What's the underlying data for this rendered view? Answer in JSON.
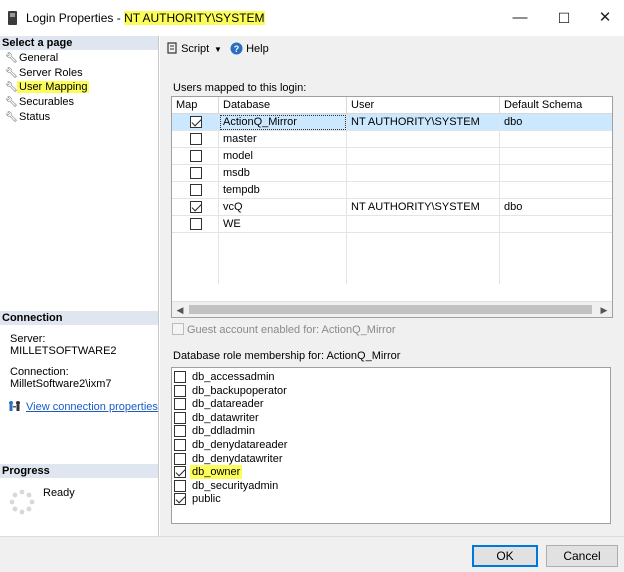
{
  "window": {
    "title_prefix": "Login Properties - ",
    "title_login": "NT AUTHORITY\\SYSTEM",
    "minimize_glyph": "—",
    "maximize_glyph": "☐",
    "close_glyph": "✕"
  },
  "left": {
    "select_page_header": "Select a page",
    "pages": [
      {
        "label": "General"
      },
      {
        "label": "Server Roles"
      },
      {
        "label": "User Mapping"
      },
      {
        "label": "Securables"
      },
      {
        "label": "Status"
      }
    ],
    "connection": {
      "header": "Connection",
      "server_label": "Server:",
      "server_value": "MILLETSOFTWARE2",
      "connection_label": "Connection:",
      "connection_value": "MilletSoftware2\\ixm7",
      "view_link": "View connection properties"
    },
    "progress": {
      "header": "Progress",
      "status": "Ready"
    }
  },
  "toolbar": {
    "script_label": "Script",
    "help_label": "Help"
  },
  "mapping": {
    "users_label": "Users mapped to this login:",
    "columns": [
      "Map",
      "Database",
      "User",
      "Default Schema"
    ],
    "rows": [
      {
        "map": true,
        "database": "ActionQ_Mirror",
        "user": "NT AUTHORITY\\SYSTEM",
        "schema": "dbo"
      },
      {
        "map": false,
        "database": "master",
        "user": "",
        "schema": ""
      },
      {
        "map": false,
        "database": "model",
        "user": "",
        "schema": ""
      },
      {
        "map": false,
        "database": "msdb",
        "user": "",
        "schema": ""
      },
      {
        "map": false,
        "database": "tempdb",
        "user": "",
        "schema": ""
      },
      {
        "map": true,
        "database": "vcQ",
        "user": "NT AUTHORITY\\SYSTEM",
        "schema": "dbo"
      },
      {
        "map": false,
        "database": "WE",
        "user": "",
        "schema": ""
      }
    ],
    "guest_label": "Guest account enabled for: ActionQ_Mirror",
    "roles_label": "Database role membership for: ActionQ_Mirror",
    "roles": [
      {
        "name": "db_accessadmin",
        "checked": false
      },
      {
        "name": "db_backupoperator",
        "checked": false
      },
      {
        "name": "db_datareader",
        "checked": false
      },
      {
        "name": "db_datawriter",
        "checked": false
      },
      {
        "name": "db_ddladmin",
        "checked": false
      },
      {
        "name": "db_denydatareader",
        "checked": false
      },
      {
        "name": "db_denydatawriter",
        "checked": false
      },
      {
        "name": "db_owner",
        "checked": true
      },
      {
        "name": "db_securityadmin",
        "checked": false
      },
      {
        "name": "public",
        "checked": true
      }
    ]
  },
  "buttons": {
    "ok": "OK",
    "cancel": "Cancel"
  },
  "colors": {
    "highlight": "#fdfd5a",
    "selected_row": "#cce8ff",
    "link": "#1a5cc6",
    "section_header": "#dfe6ef"
  }
}
